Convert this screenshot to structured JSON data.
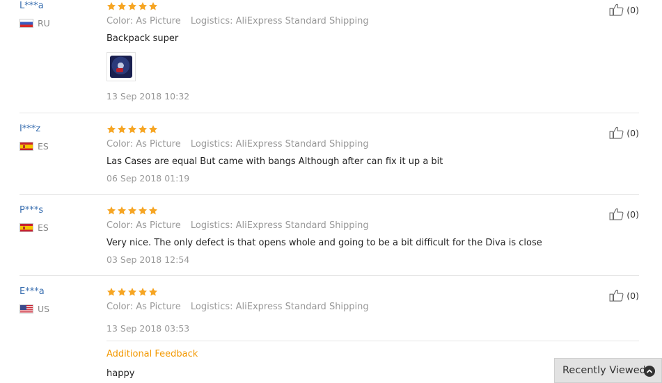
{
  "reviews": [
    {
      "user": "L***a",
      "country": "RU",
      "flag": "ru",
      "color_label": "Color:",
      "color_value": "As Picture",
      "logistics_label": "Logistics:",
      "logistics_value": "AliExpress Standard Shipping",
      "text": "Backpack super",
      "date": "13 Sep 2018 10:32",
      "helpful": "(0)",
      "rating": 5,
      "has_image": true
    },
    {
      "user": "I***z",
      "country": "ES",
      "flag": "es",
      "color_label": "Color:",
      "color_value": "As Picture",
      "logistics_label": "Logistics:",
      "logistics_value": "AliExpress Standard Shipping",
      "text": "Las Cases are equal But came with bangs Although after can fix it up a bit",
      "date": "06 Sep 2018 01:19",
      "helpful": "(0)",
      "rating": 5
    },
    {
      "user": "P***s",
      "country": "ES",
      "flag": "es",
      "color_label": "Color:",
      "color_value": "As Picture",
      "logistics_label": "Logistics:",
      "logistics_value": "AliExpress Standard Shipping",
      "text": "Very nice. The only defect is that opens whole and going to be a bit difficult for the Diva is close",
      "date": "03 Sep 2018 12:54",
      "helpful": "(0)",
      "rating": 5
    },
    {
      "user": "E***a",
      "country": "US",
      "flag": "us",
      "color_label": "Color:",
      "color_value": "As Picture",
      "logistics_label": "Logistics:",
      "logistics_value": "AliExpress Standard Shipping",
      "date": "13 Sep 2018 03:53",
      "helpful": "(0)",
      "rating": 5,
      "additional_title": "Additional Feedback",
      "additional_text": "happy"
    }
  ],
  "recently_viewed": "Recently Viewed",
  "colors": {
    "star": "#f6a523",
    "user_link": "#3a6fb0",
    "additional_title": "#f39800",
    "meta": "#999999"
  },
  "icons": {
    "star": "star-icon",
    "thumbs_up": "thumbs-up-icon",
    "chevron_up": "chevron-up-circle-icon"
  }
}
